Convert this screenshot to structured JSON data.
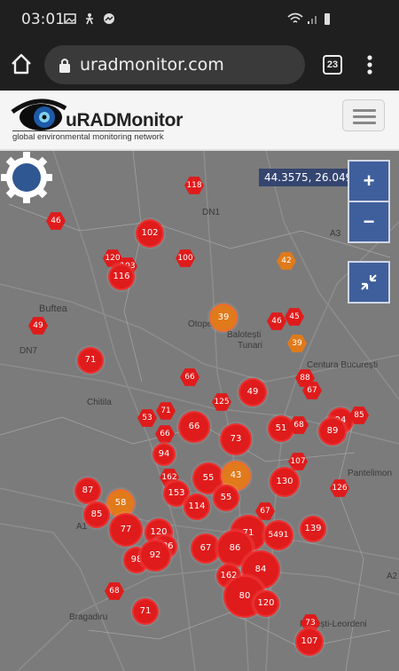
{
  "status_bar": {
    "time": "03:01"
  },
  "browser": {
    "url": "uradmonitor.com",
    "tab_count": "23"
  },
  "site": {
    "brand": "uRADMonitor",
    "tagline": "global environmental monitoring network"
  },
  "map": {
    "coordinates": "44.3575, 26.0491",
    "zoom_in": "+",
    "zoom_out": "−",
    "labels": [
      {
        "text": "DN1"
      },
      {
        "text": "Buftea"
      },
      {
        "text": "DN7"
      },
      {
        "text": "Otopeni"
      },
      {
        "text": "Balotești"
      },
      {
        "text": "Tunari"
      },
      {
        "text": "Chitila"
      },
      {
        "text": "Centura București"
      },
      {
        "text": "Pantelimon"
      },
      {
        "text": "Bragadiru"
      },
      {
        "text": "Popești-Leordeni"
      },
      {
        "text": "A3"
      },
      {
        "text": "A1"
      },
      {
        "text": "A2"
      }
    ],
    "markers": [
      {
        "value": "118",
        "shape": "hex",
        "color": "red"
      },
      {
        "value": "46",
        "shape": "hex",
        "color": "red"
      },
      {
        "value": "102",
        "shape": "circle",
        "color": "red"
      },
      {
        "value": "120",
        "shape": "hex",
        "color": "red"
      },
      {
        "value": "103",
        "shape": "hex",
        "color": "red"
      },
      {
        "value": "116",
        "shape": "circle",
        "color": "red"
      },
      {
        "value": "100",
        "shape": "hex",
        "color": "red"
      },
      {
        "value": "42",
        "shape": "hex",
        "color": "orange"
      },
      {
        "value": "49",
        "shape": "hex",
        "color": "red"
      },
      {
        "value": "39",
        "shape": "circle",
        "color": "orange"
      },
      {
        "value": "46",
        "shape": "hex",
        "color": "red"
      },
      {
        "value": "45",
        "shape": "hex",
        "color": "red"
      },
      {
        "value": "39",
        "shape": "hex",
        "color": "orange"
      },
      {
        "value": "71",
        "shape": "circle",
        "color": "red"
      },
      {
        "value": "88",
        "shape": "hex",
        "color": "red"
      },
      {
        "value": "67",
        "shape": "hex",
        "color": "red"
      },
      {
        "value": "66",
        "shape": "hex",
        "color": "red"
      },
      {
        "value": "125",
        "shape": "hex",
        "color": "red"
      },
      {
        "value": "49",
        "shape": "circle",
        "color": "red"
      },
      {
        "value": "53",
        "shape": "hex",
        "color": "red"
      },
      {
        "value": "71",
        "shape": "hex",
        "color": "red"
      },
      {
        "value": "66",
        "shape": "circle",
        "color": "red"
      },
      {
        "value": "66",
        "shape": "hex",
        "color": "red"
      },
      {
        "value": "51",
        "shape": "circle",
        "color": "red"
      },
      {
        "value": "68",
        "shape": "hex",
        "color": "red"
      },
      {
        "value": "94",
        "shape": "circle",
        "color": "red"
      },
      {
        "value": "85",
        "shape": "hex",
        "color": "red"
      },
      {
        "value": "89",
        "shape": "circle",
        "color": "red"
      },
      {
        "value": "73",
        "shape": "circle",
        "color": "red"
      },
      {
        "value": "94",
        "shape": "circle",
        "color": "red"
      },
      {
        "value": "107",
        "shape": "hex",
        "color": "red"
      },
      {
        "value": "162",
        "shape": "hex",
        "color": "red"
      },
      {
        "value": "55",
        "shape": "circle",
        "color": "red"
      },
      {
        "value": "43",
        "shape": "circle",
        "color": "orange"
      },
      {
        "value": "130",
        "shape": "circle",
        "color": "red"
      },
      {
        "value": "126",
        "shape": "hex",
        "color": "red"
      },
      {
        "value": "153",
        "shape": "circle",
        "color": "red"
      },
      {
        "value": "87",
        "shape": "circle",
        "color": "red"
      },
      {
        "value": "58",
        "shape": "circle",
        "color": "orange"
      },
      {
        "value": "85",
        "shape": "circle",
        "color": "red"
      },
      {
        "value": "114",
        "shape": "circle",
        "color": "red"
      },
      {
        "value": "55",
        "shape": "circle",
        "color": "red"
      },
      {
        "value": "67",
        "shape": "hex",
        "color": "red"
      },
      {
        "value": "77",
        "shape": "circle",
        "color": "red"
      },
      {
        "value": "120",
        "shape": "circle",
        "color": "red"
      },
      {
        "value": "106",
        "shape": "circle",
        "color": "red"
      },
      {
        "value": "71",
        "shape": "circle",
        "color": "red"
      },
      {
        "value": "5491",
        "shape": "circle",
        "color": "red"
      },
      {
        "value": "139",
        "shape": "circle",
        "color": "red"
      },
      {
        "value": "98",
        "shape": "circle",
        "color": "red"
      },
      {
        "value": "92",
        "shape": "circle",
        "color": "red"
      },
      {
        "value": "67",
        "shape": "circle",
        "color": "red"
      },
      {
        "value": "86",
        "shape": "circle",
        "color": "red"
      },
      {
        "value": "84",
        "shape": "circle",
        "color": "red"
      },
      {
        "value": "162",
        "shape": "circle",
        "color": "red"
      },
      {
        "value": "68",
        "shape": "hex",
        "color": "red"
      },
      {
        "value": "80",
        "shape": "circle",
        "color": "red"
      },
      {
        "value": "120",
        "shape": "circle",
        "color": "red"
      },
      {
        "value": "71",
        "shape": "circle",
        "color": "red"
      },
      {
        "value": "73",
        "shape": "hex",
        "color": "red"
      },
      {
        "value": "107",
        "shape": "circle",
        "color": "red"
      }
    ]
  },
  "colors": {
    "red": "#e01b1b",
    "orange": "#e07a1b",
    "accent": "#3f5f9c"
  }
}
